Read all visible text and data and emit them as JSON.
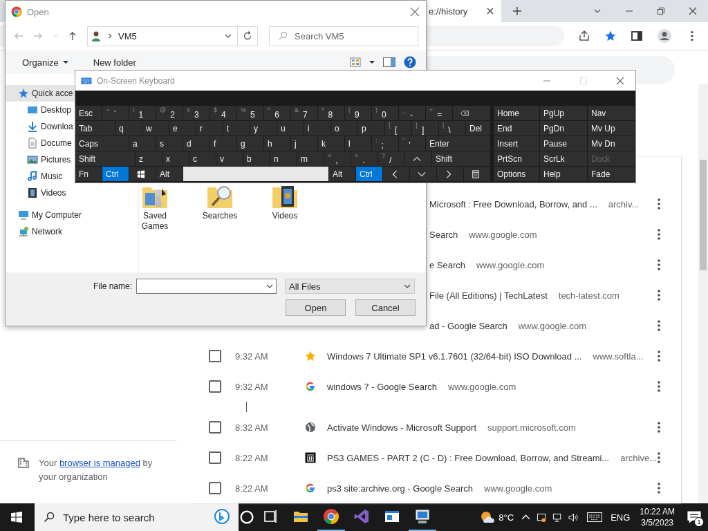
{
  "browser": {
    "tab_title": "e://history",
    "history_rows": [
      {
        "title": "Microsoft : Free Download, Borrow, and ...",
        "domain": "archiv...",
        "new_group": false
      },
      {
        "title": "Search",
        "domain": "www.google.com",
        "new_group": false
      },
      {
        "title": "e Search",
        "domain": "www.google.com",
        "new_group": false
      },
      {
        "title": "File (All Editions) | TechLatest",
        "domain": "tech-latest.com",
        "new_group": false
      },
      {
        "title": "ad - Google Search",
        "domain": "www.google.com",
        "new_group": false
      },
      {
        "time": "9:32 AM",
        "checked": false,
        "kind": "star",
        "title": "Windows 7 Ultimate SP1 v6.1.7601 (32/64-bit) ISO Download ...",
        "domain": "www.softla...",
        "new_group": false
      },
      {
        "time": "9:32 AM",
        "checked": false,
        "kind": "google",
        "title": "windows 7 - Google Search",
        "domain": "www.google.com",
        "new_group": false
      },
      {
        "time": "8:32 AM",
        "checked": false,
        "kind": "globe",
        "title": "Activate Windows - Microsoft Support",
        "domain": "support.microsoft.com",
        "new_group": true
      },
      {
        "time": "8:22 AM",
        "checked": false,
        "kind": "archive",
        "title": "PS3 GAMES - PART 2 (C - D) : Free Download, Borrow, and Streami...",
        "domain": "archive...",
        "new_group": false
      },
      {
        "time": "8:22 AM",
        "checked": false,
        "kind": "google",
        "title": "ps3 site:archive.org - Google Search",
        "domain": "www.google.com",
        "new_group": false
      }
    ],
    "managed_notice": {
      "before": "Your ",
      "link": "browser is managed",
      "after": " by your organization"
    }
  },
  "open_dialog": {
    "title": "Open",
    "path": "VM5",
    "search_placeholder": "Search VM5",
    "organize": "Organize",
    "new_folder": "New folder",
    "sidebar": [
      {
        "label": "Quick acce",
        "kind": "star",
        "selected": true,
        "children": [
          {
            "label": "Desktop",
            "kind": "desktop",
            "selected": false
          },
          {
            "label": "Downloa",
            "kind": "downloads",
            "selected": false
          },
          {
            "label": "Docume",
            "kind": "documents",
            "selected": false
          },
          {
            "label": "Pictures",
            "kind": "pictures",
            "selected": false
          },
          {
            "label": "Music",
            "kind": "music",
            "selected": false
          },
          {
            "label": "Videos",
            "kind": "videos",
            "selected": false
          }
        ]
      },
      {
        "label": "My Computer",
        "kind": "computer",
        "selected": false
      },
      {
        "label": "Network",
        "kind": "network",
        "selected": false
      }
    ],
    "folders": [
      {
        "label": "Saved Games",
        "kind": "games"
      },
      {
        "label": "Searches",
        "kind": "search"
      },
      {
        "label": "Videos",
        "kind": "videos"
      }
    ],
    "file_name_label": "File name:",
    "file_type": "All Files",
    "buttons": [
      "Open",
      "Cancel"
    ]
  },
  "keyboard": {
    "title": "On-Screen Keyboard",
    "key_rows": [
      {
        "keys": [
          {
            "kind": "text",
            "label": "Esc",
            "pressed": false
          },
          {
            "kind": "char",
            "shift": "~",
            "label": "`",
            "pressed": false
          },
          {
            "kind": "char",
            "shift": "!",
            "label": "1",
            "pressed": false
          },
          {
            "kind": "char",
            "shift": "@",
            "label": "2",
            "pressed": false
          },
          {
            "kind": "char",
            "shift": "#",
            "label": "3",
            "pressed": false
          },
          {
            "kind": "char",
            "shift": "$",
            "label": "4",
            "pressed": false
          },
          {
            "kind": "char",
            "shift": "%",
            "label": "5",
            "pressed": false
          },
          {
            "kind": "char",
            "shift": "^",
            "label": "6",
            "pressed": false
          },
          {
            "kind": "char",
            "shift": "&",
            "label": "7",
            "pressed": false
          },
          {
            "kind": "char",
            "shift": "*",
            "label": "8",
            "pressed": false
          },
          {
            "kind": "char",
            "shift": "(",
            "label": "9",
            "pressed": false
          },
          {
            "kind": "char",
            "shift": ")",
            "label": "0",
            "pressed": false
          },
          {
            "kind": "char",
            "shift": "_",
            "label": "-",
            "pressed": false
          },
          {
            "kind": "char",
            "shift": "+",
            "label": "=",
            "pressed": false
          },
          {
            "kind": "backspace",
            "pressed": false
          }
        ]
      },
      {
        "keys": [
          {
            "kind": "text",
            "label": "Tab",
            "pressed": false
          },
          {
            "kind": "char",
            "label": "q",
            "pressed": false
          },
          {
            "kind": "char",
            "label": "w",
            "pressed": false
          },
          {
            "kind": "char",
            "label": "e",
            "pressed": false
          },
          {
            "kind": "char",
            "label": "r",
            "pressed": false
          },
          {
            "kind": "char",
            "label": "t",
            "pressed": false
          },
          {
            "kind": "char",
            "label": "y",
            "pressed": false
          },
          {
            "kind": "char",
            "label": "u",
            "pressed": false
          },
          {
            "kind": "char",
            "label": "i",
            "pressed": false
          },
          {
            "kind": "char",
            "label": "o",
            "pressed": false
          },
          {
            "kind": "char",
            "label": "p",
            "pressed": false
          },
          {
            "kind": "char",
            "shift": "{",
            "label": "[",
            "pressed": false
          },
          {
            "kind": "char",
            "shift": "}",
            "label": "]",
            "pressed": false
          },
          {
            "kind": "char",
            "shift": "|",
            "label": "\\",
            "pressed": false
          },
          {
            "kind": "text",
            "label": "Del",
            "pressed": false
          }
        ]
      },
      {
        "keys": [
          {
            "kind": "text",
            "label": "Caps",
            "pressed": false
          },
          {
            "kind": "char",
            "label": "a",
            "pressed": false
          },
          {
            "kind": "char",
            "label": "s",
            "pressed": false
          },
          {
            "kind": "char",
            "label": "d",
            "pressed": false
          },
          {
            "kind": "char",
            "label": "f",
            "pressed": false
          },
          {
            "kind": "char",
            "label": "g",
            "pressed": false
          },
          {
            "kind": "char",
            "label": "h",
            "pressed": false
          },
          {
            "kind": "char",
            "label": "j",
            "pressed": false
          },
          {
            "kind": "char",
            "label": "k",
            "pressed": false
          },
          {
            "kind": "char",
            "label": "l",
            "pressed": false
          },
          {
            "kind": "char",
            "shift": ":",
            "label": ";",
            "pressed": false
          },
          {
            "kind": "char",
            "shift": "\"",
            "label": "'",
            "pressed": false
          },
          {
            "kind": "text",
            "label": "Enter",
            "pressed": false
          }
        ]
      },
      {
        "keys": [
          {
            "kind": "text",
            "label": "Shift",
            "pressed": false
          },
          {
            "kind": "char",
            "label": "z",
            "pressed": false
          },
          {
            "kind": "char",
            "label": "x",
            "pressed": false
          },
          {
            "kind": "char",
            "label": "c",
            "pressed": false
          },
          {
            "kind": "char",
            "label": "v",
            "pressed": false
          },
          {
            "kind": "char",
            "label": "b",
            "pressed": false
          },
          {
            "kind": "char",
            "label": "n",
            "pressed": false
          },
          {
            "kind": "char",
            "label": "m",
            "pressed": false
          },
          {
            "kind": "char",
            "shift": "<",
            "label": ",",
            "pressed": false
          },
          {
            "kind": "char",
            "shift": ">",
            "label": ".",
            "pressed": false
          },
          {
            "kind": "char",
            "shift": "?",
            "label": "/",
            "pressed": false
          },
          {
            "kind": "up",
            "pressed": false
          },
          {
            "kind": "text",
            "label": "Shift",
            "pressed": false
          }
        ]
      },
      {
        "keys": [
          {
            "kind": "text",
            "label": "Fn",
            "pressed": false
          },
          {
            "kind": "text",
            "label": "Ctrl",
            "pressed": true
          },
          {
            "kind": "windows",
            "pressed": false
          },
          {
            "kind": "text",
            "label": "Alt",
            "pressed": false
          },
          {
            "kind": "space",
            "pressed": false
          },
          {
            "kind": "text",
            "label": "Alt",
            "pressed": false
          },
          {
            "kind": "text",
            "label": "Ctrl",
            "pressed": true
          },
          {
            "kind": "left",
            "pressed": false
          },
          {
            "kind": "down",
            "pressed": false
          },
          {
            "kind": "right",
            "pressed": false
          },
          {
            "kind": "menu",
            "pressed": false
          }
        ]
      }
    ],
    "nav_keys": [
      {
        "label": "Home",
        "disabled": false
      },
      {
        "label": "PgUp",
        "disabled": false
      },
      {
        "label": "Nav",
        "disabled": false
      },
      {
        "label": "End",
        "disabled": false
      },
      {
        "label": "PgDn",
        "disabled": false
      },
      {
        "label": "Mv Up",
        "disabled": false
      },
      {
        "label": "Insert",
        "disabled": false
      },
      {
        "label": "Pause",
        "disabled": false
      },
      {
        "label": "Mv Dn",
        "disabled": false
      },
      {
        "label": "PrtScn",
        "disabled": false
      },
      {
        "label": "ScrLk",
        "disabled": false
      },
      {
        "label": "Dock",
        "disabled": true
      },
      {
        "label": "Options",
        "disabled": false
      },
      {
        "label": "Help",
        "disabled": false
      },
      {
        "label": "Fade",
        "disabled": false
      }
    ]
  },
  "taskbar": {
    "search_placeholder": "Type here to search",
    "apps": [
      {
        "kind": "taskview",
        "running": false
      },
      {
        "kind": "explorer",
        "running": false
      },
      {
        "kind": "chrome",
        "running": true
      },
      {
        "kind": "studio",
        "running": false
      },
      {
        "kind": "window",
        "running": false
      },
      {
        "kind": "remote",
        "running": true
      }
    ],
    "weather": "8°C",
    "language": "ENG",
    "time": "10:22 AM",
    "date": "3/5/2023",
    "notifications": "1"
  }
}
